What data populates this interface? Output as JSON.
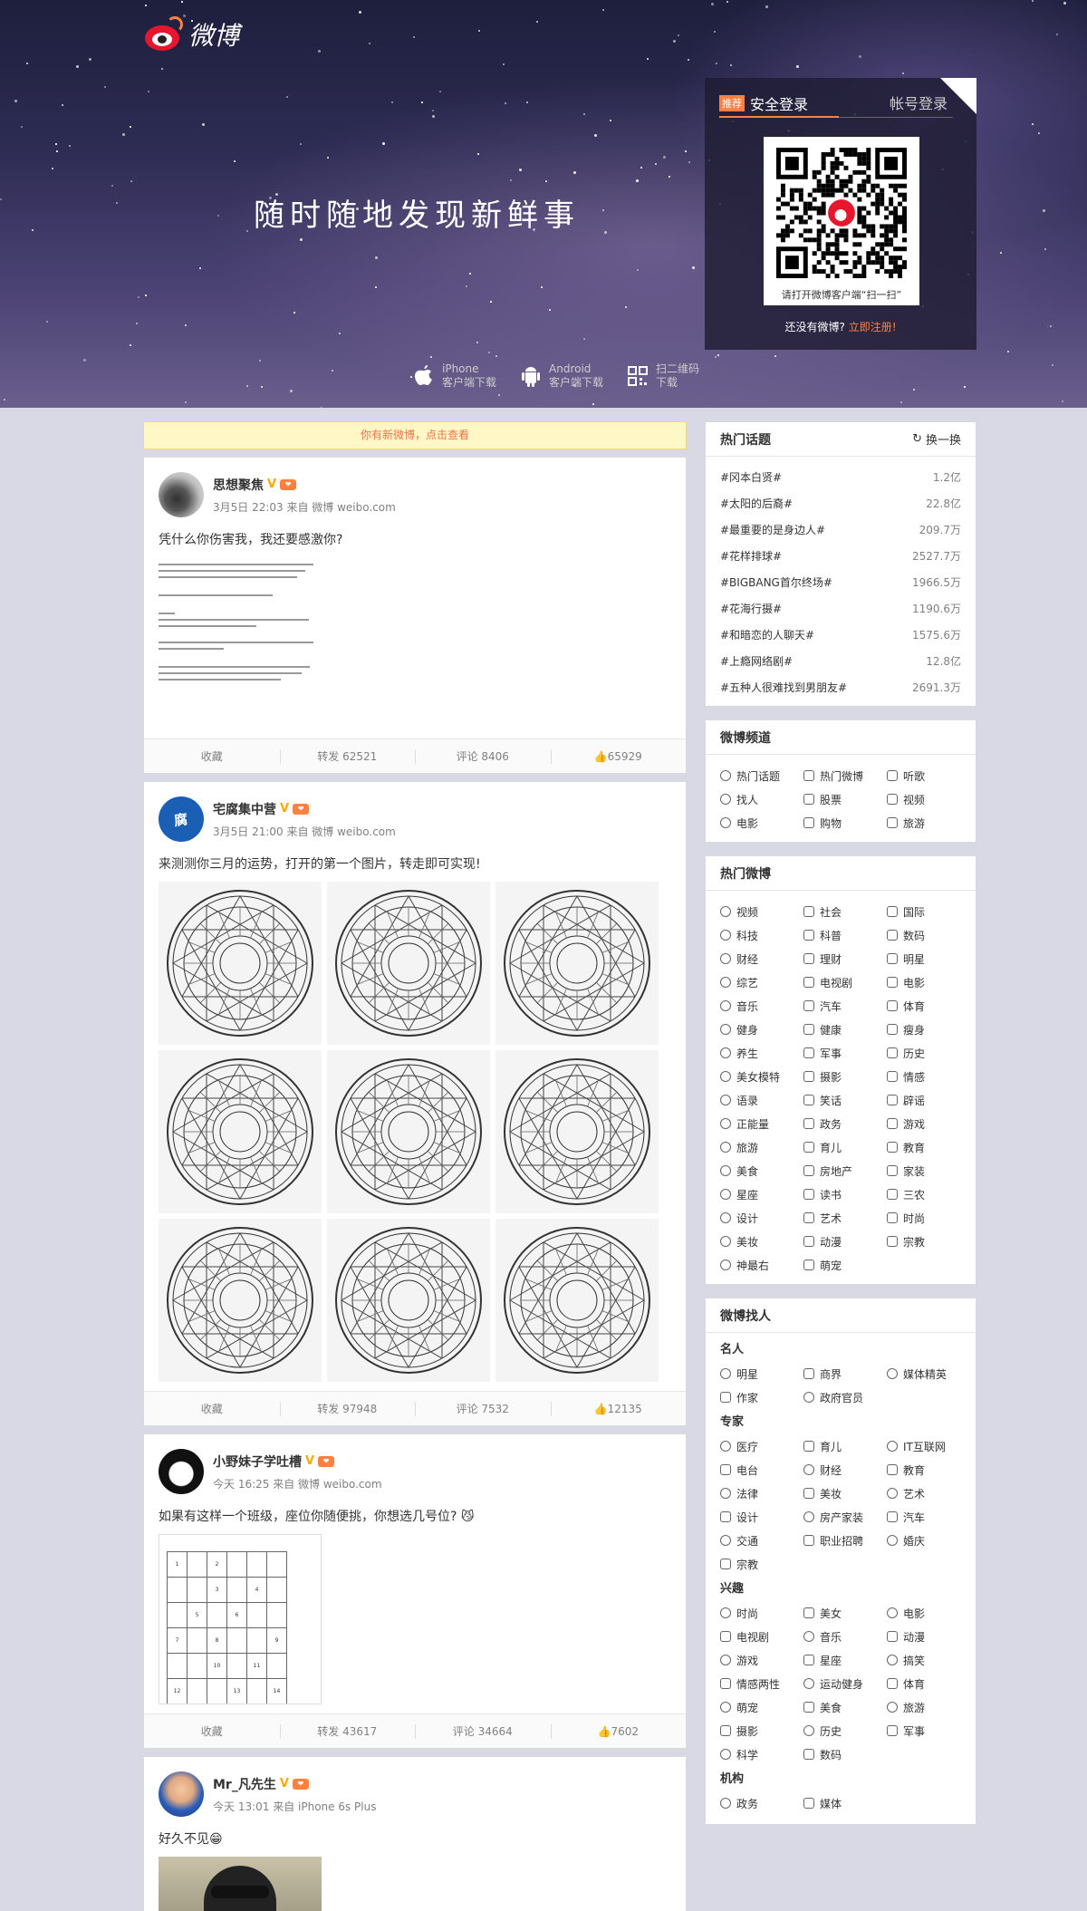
{
  "logo": {
    "text": "微博"
  },
  "banner": {
    "slogan": "随时随地发现新鲜事"
  },
  "login": {
    "tag": "推荐",
    "tab_safe": "安全登录",
    "tab_account": "帐号登录",
    "qr_caption": "请打开微博客户端“扫一扫”",
    "register_prompt": "还没有微博?",
    "register_link": "立即注册!"
  },
  "downloads": [
    {
      "title": "iPhone",
      "sub": "客户端下载",
      "icon": "apple-icon"
    },
    {
      "title": "Android",
      "sub": "客户端下载",
      "icon": "android-icon"
    },
    {
      "title": "扫二维码",
      "sub": "下载",
      "icon": "qrcode-icon"
    }
  ],
  "notice": "你有新微博，点击查看",
  "actions": {
    "fav": "收藏"
  },
  "posts": [
    {
      "nick": "思想聚焦",
      "meta": "3月5日 22:03 来自 微博 weibo.com",
      "text": "凭什么你伤害我，我还要感激你?",
      "repost": "转发 62521",
      "comment": "评论 8406",
      "like": "65929"
    },
    {
      "nick": "宅腐集中营",
      "meta": "3月5日 21:00 来自 微博 weibo.com",
      "text": "来测测你三月的运势，打开的第一个图片，转走即可实现!",
      "repost": "转发 97948",
      "comment": "评论 7532",
      "like": "12135"
    },
    {
      "nick": "小野妹子学吐槽",
      "meta": "今天 16:25 来自 微博 weibo.com",
      "text": "如果有这样一个班级，座位你随便挑，你想选几号位? 😼",
      "repost": "转发 43617",
      "comment": "评论 34664",
      "like": "7602"
    },
    {
      "nick": "Mr_凡先生",
      "meta": "今天 13:01 来自 iPhone 6s Plus",
      "text": "好久不见😁"
    }
  ],
  "hot_topics": {
    "title": "热门话题",
    "swap": "换一换",
    "items": [
      {
        "name": "#冈本白贤#",
        "count": "1.2亿"
      },
      {
        "name": "#太阳的后裔#",
        "count": "22.8亿"
      },
      {
        "name": "#最重要的是身边人#",
        "count": "209.7万"
      },
      {
        "name": "#花样排球#",
        "count": "2527.7万"
      },
      {
        "name": "#BIGBANG首尔终场#",
        "count": "1966.5万"
      },
      {
        "name": "#花海行摄#",
        "count": "1190.6万"
      },
      {
        "name": "#和暗恋的人聊天#",
        "count": "1575.6万"
      },
      {
        "name": "#上瘾网络剧#",
        "count": "12.8亿"
      },
      {
        "name": "#五种人很难找到男朋友#",
        "count": "2691.3万"
      }
    ]
  },
  "channels": {
    "title": "微博频道",
    "items": [
      "热门话题",
      "热门微博",
      "听歌",
      "找人",
      "股票",
      "视频",
      "电影",
      "购物",
      "旅游"
    ]
  },
  "hot_weibo": {
    "title": "热门微博",
    "items": [
      "视频",
      "社会",
      "国际",
      "科技",
      "科普",
      "数码",
      "财经",
      "理财",
      "明星",
      "综艺",
      "电视剧",
      "电影",
      "音乐",
      "汽车",
      "体育",
      "健身",
      "健康",
      "瘦身",
      "养生",
      "军事",
      "历史",
      "美女模特",
      "摄影",
      "情感",
      "语录",
      "笑话",
      "辟谣",
      "正能量",
      "政务",
      "游戏",
      "旅游",
      "育儿",
      "教育",
      "美食",
      "房地产",
      "家装",
      "星座",
      "读书",
      "三农",
      "设计",
      "艺术",
      "时尚",
      "美妆",
      "动漫",
      "宗教",
      "神最右",
      "萌宠"
    ]
  },
  "find_people": {
    "title": "微博找人",
    "groups": [
      {
        "name": "名人",
        "items": [
          "明星",
          "商界",
          "媒体精英",
          "作家",
          "政府官员"
        ]
      },
      {
        "name": "专家",
        "items": [
          "医疗",
          "育儿",
          "IT互联网",
          "电台",
          "财经",
          "教育",
          "法律",
          "美妆",
          "艺术",
          "设计",
          "房产家装",
          "汽车",
          "交通",
          "职业招聘",
          "婚庆",
          "宗教"
        ]
      },
      {
        "name": "兴趣",
        "items": [
          "时尚",
          "美女",
          "电影",
          "电视剧",
          "音乐",
          "动漫",
          "游戏",
          "星座",
          "搞笑",
          "情感两性",
          "运动健身",
          "体育",
          "萌宠",
          "美食",
          "旅游",
          "摄影",
          "历史",
          "军事",
          "科学",
          "数码"
        ]
      },
      {
        "name": "机构",
        "items": [
          "政务",
          "媒体"
        ]
      }
    ]
  }
}
